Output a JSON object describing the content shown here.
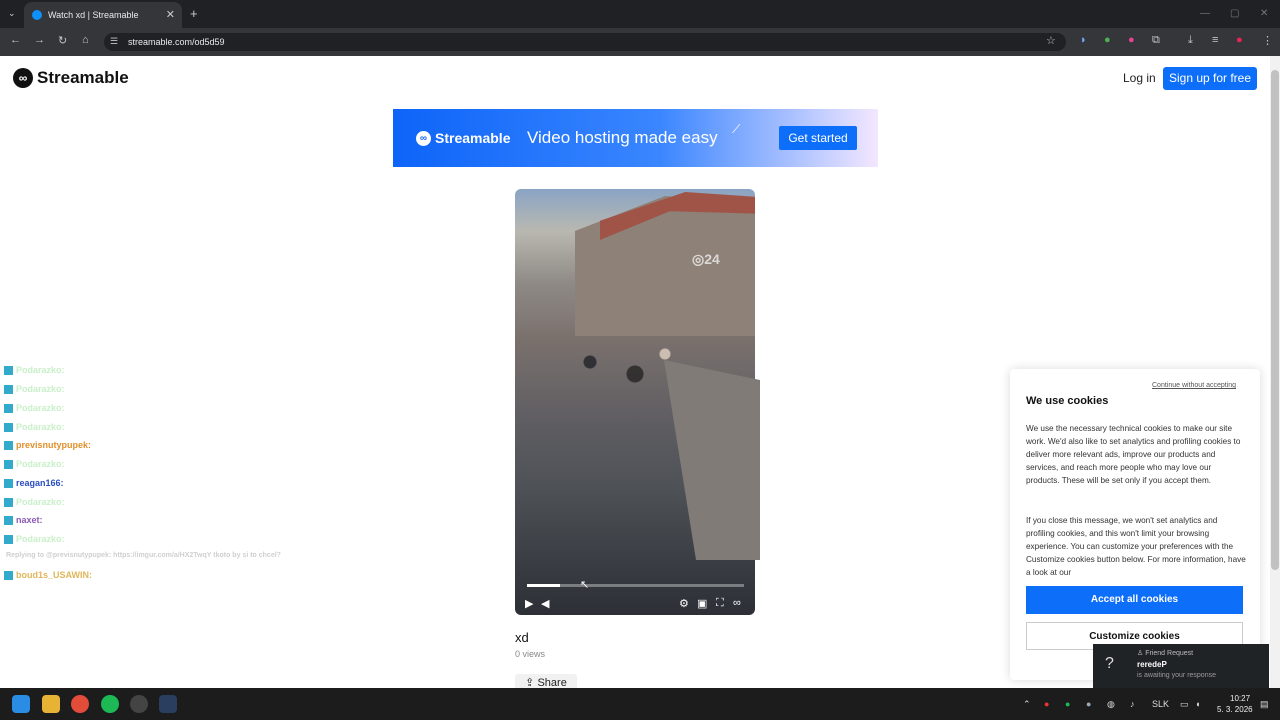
{
  "browser": {
    "tab_title": "Watch xd | Streamable",
    "url": "streamable.com/od5d59",
    "lang": "SLK"
  },
  "site": {
    "brand": "Streamable",
    "login": "Log in",
    "signup": "Sign up for free"
  },
  "banner": {
    "brand": "Streamable",
    "tagline": "Video hosting made easy",
    "cta": "Get started"
  },
  "video": {
    "watermark": "24",
    "progress": 0.15,
    "title": "xd",
    "views": "0 views",
    "share": "Share"
  },
  "chat": [
    {
      "user": "Podarazko:",
      "msg": "",
      "color": "green"
    },
    {
      "user": "Podarazko:",
      "msg": "",
      "color": "green"
    },
    {
      "user": "Podarazko:",
      "msg": "",
      "color": "green"
    },
    {
      "user": "Podarazko:",
      "msg": "",
      "color": "green"
    },
    {
      "user": "previsnutypupek:",
      "msg": "",
      "color": "orange"
    },
    {
      "user": "Podarazko:",
      "msg": "",
      "color": "green"
    },
    {
      "user": "reagan166:",
      "msg": "",
      "color": "blue"
    },
    {
      "user": "Podarazko:",
      "msg": "",
      "color": "green"
    },
    {
      "user": "naxet:",
      "msg": "",
      "color": "purple"
    },
    {
      "user": "Podarazko:",
      "msg": "",
      "color": "green"
    },
    {
      "user": "boud1s_USAWIN:",
      "msg": "",
      "color": "gold"
    }
  ],
  "chat_reply": "Replying to @previsnutypupek: https://imgur.com/a/HX2TwqY tkoto by si to chcel?",
  "cookie": {
    "skip": "Continue without accepting",
    "title": "We use cookies",
    "p1": "We use the necessary technical cookies to make our site work. We'd also like to set analytics and profiling cookies to deliver more relevant ads, improve our products and services, and reach more people who may love our products. These will be set only if you accept them.",
    "p2": "If you close this message, we won't set analytics and profiling cookies, and this won't limit your browsing experience. You can customize your preferences with the Customize cookies button below. For more information, have a look at our",
    "accept": "Accept all cookies",
    "customize": "Customize cookies"
  },
  "toast": {
    "header": "Friend Request",
    "name": "reredeP",
    "sub": "is awaiting your response"
  },
  "clock": {
    "time": "10:27",
    "date": "5. 3. 2026"
  }
}
